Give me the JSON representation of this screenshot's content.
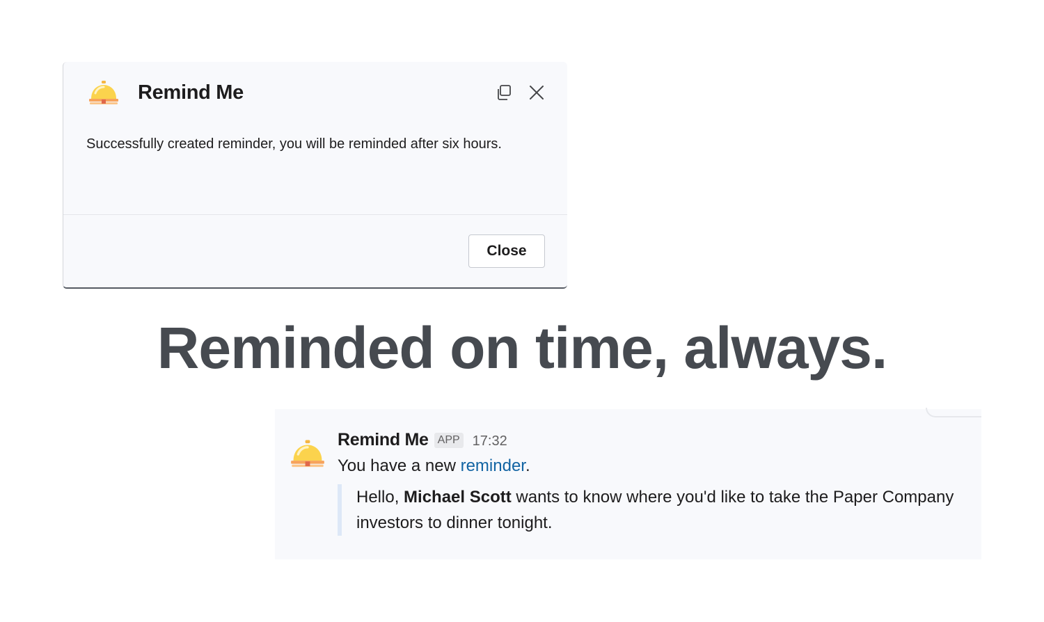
{
  "modal": {
    "title": "Remind Me",
    "icon": "service-bell-icon",
    "body": "Successfully created reminder, you will be reminded after six hours.",
    "close_button_label": "Close"
  },
  "headline": "Reminded on time, always.",
  "message": {
    "author": "Remind Me",
    "badge": "APP",
    "time": "17:32",
    "text_before_link": "You have a new ",
    "link_text": "reminder",
    "text_after_link": ".",
    "quote": {
      "prefix": "Hello, ",
      "name": "Michael Scott",
      "suffix": " wants to know where you'd like to take the Paper Company investors to dinner tonight."
    }
  },
  "colors": {
    "headline": "#464a50",
    "link": "#1264a3",
    "panel_background": "#f8f9fc",
    "quote_bar": "#dde8f7"
  }
}
